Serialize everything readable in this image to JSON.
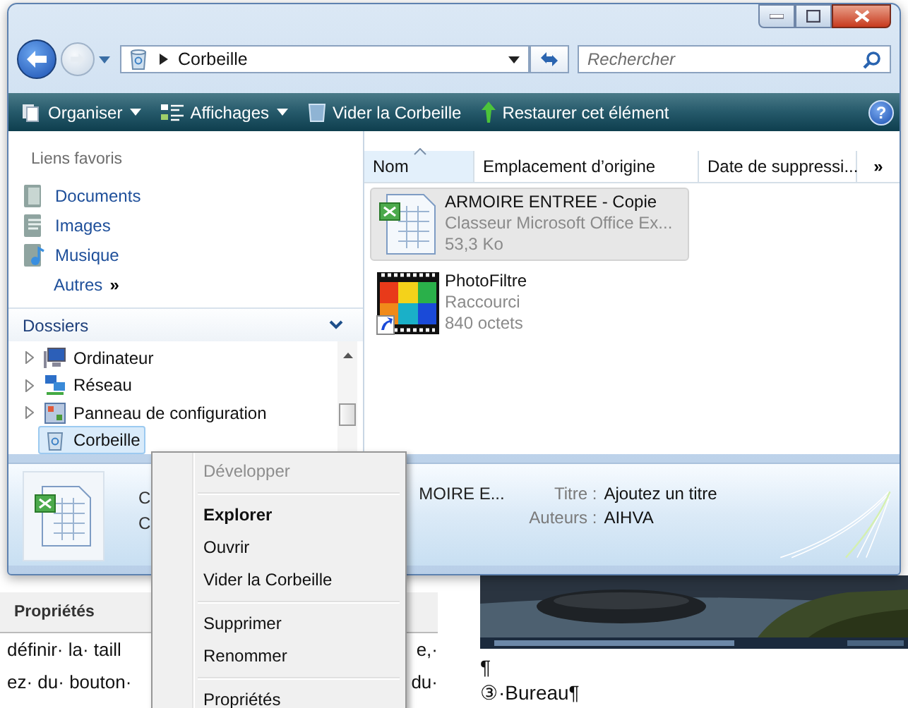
{
  "navigation": {
    "address": "Corbeille",
    "search": {
      "placeholder": "Rechercher"
    }
  },
  "toolbar": {
    "items": [
      {
        "label": "Organiser",
        "kind": "organize",
        "dropdown": true
      },
      {
        "label": "Affichages",
        "kind": "views",
        "dropdown": true
      },
      {
        "label": "Vider la Corbeille",
        "kind": "empty",
        "dropdown": false
      },
      {
        "label": "Restaurer cet élément",
        "kind": "restore",
        "dropdown": false
      }
    ],
    "help": "?"
  },
  "favorites": {
    "title": "Liens favoris",
    "items": [
      {
        "label": "Documents",
        "kind": "documents"
      },
      {
        "label": "Images",
        "kind": "images"
      },
      {
        "label": "Musique",
        "kind": "music"
      }
    ],
    "more": {
      "label": "Autres",
      "chevron": "»"
    }
  },
  "folders": {
    "title": "Dossiers",
    "items": [
      {
        "label": "Ordinateur",
        "kind": "computer",
        "expandable": true,
        "selected": false
      },
      {
        "label": "Réseau",
        "kind": "network",
        "expandable": true,
        "selected": false
      },
      {
        "label": "Panneau de configuration",
        "kind": "control",
        "expandable": true,
        "selected": false
      },
      {
        "label": "Corbeille",
        "kind": "recycle",
        "expandable": false,
        "selected": true
      }
    ]
  },
  "columns": [
    {
      "label": "Nom",
      "sorted": true
    },
    {
      "label": "Emplacement d’origine",
      "sorted": false
    },
    {
      "label": "Date de suppressi...",
      "sorted": false
    }
  ],
  "columns_more": "»",
  "files": [
    {
      "name": "ARMOIRE ENTREE - Copie",
      "type": "Classeur Microsoft Office Ex...",
      "size": "53,3 Ko",
      "kind": "spreadsheet",
      "selected": true
    },
    {
      "name": "PhotoFiltre",
      "type": "Raccourci",
      "size": "840 octets",
      "kind": "shortcut",
      "selected": false
    }
  ],
  "details": {
    "lines": [
      "C",
      "C"
    ],
    "name": "MOIRE E...",
    "properties": [
      {
        "label": "Titre :",
        "value": "Ajoutez un titre"
      },
      {
        "label": "Auteurs :",
        "value": "AIHVA"
      }
    ]
  },
  "context_menu": [
    {
      "kind": "item",
      "label": "Développer",
      "disabled": true,
      "default": false
    },
    {
      "kind": "separator"
    },
    {
      "kind": "item",
      "label": "Explorer",
      "disabled": false,
      "default": true
    },
    {
      "kind": "item",
      "label": "Ouvrir",
      "disabled": false,
      "default": false
    },
    {
      "kind": "item",
      "label": "Vider la Corbeille",
      "disabled": false,
      "default": false
    },
    {
      "kind": "separator"
    },
    {
      "kind": "item",
      "label": "Supprimer",
      "disabled": false,
      "default": false
    },
    {
      "kind": "item",
      "label": "Renommer",
      "disabled": false,
      "default": false
    },
    {
      "kind": "separator"
    },
    {
      "kind": "item",
      "label": "Propriétés",
      "disabled": false,
      "default": false
    }
  ],
  "document": {
    "panel_title": "Propriétés",
    "lines": [
      {
        "left": "définir· la· taill",
        "right": "e,·"
      },
      {
        "left": "ez· du· bouton·",
        "right": "du·"
      }
    ],
    "right_lines": [
      "¶",
      "③·Bureau¶"
    ]
  }
}
